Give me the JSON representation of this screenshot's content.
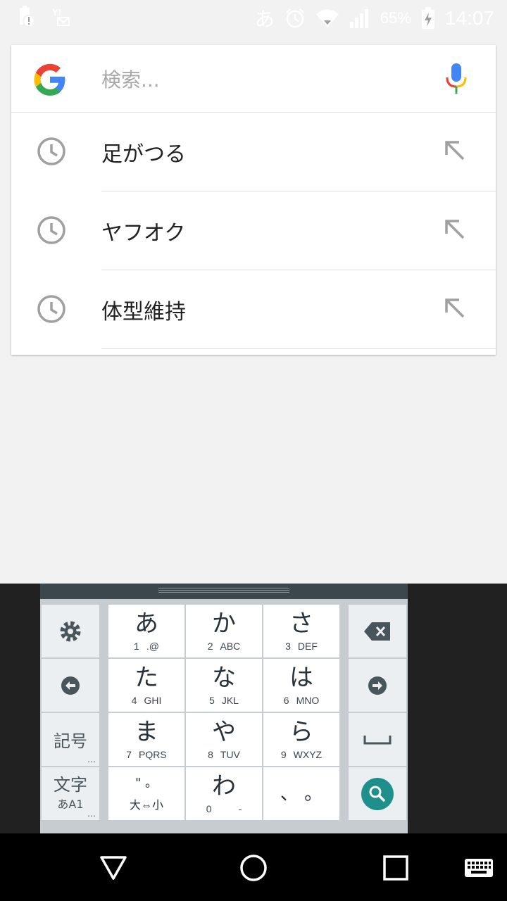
{
  "status_bar": {
    "ime_label": "あ",
    "battery_percent": "65%",
    "time": "14:07"
  },
  "search": {
    "placeholder": "検索..."
  },
  "suggestions": [
    {
      "text": "足がつる"
    },
    {
      "text": "ヤフオク"
    },
    {
      "text": "体型維持"
    }
  ],
  "keyboard": {
    "keys": [
      {
        "main": "あ",
        "sub1": "1",
        "sub2": ".@"
      },
      {
        "main": "か",
        "sub1": "2",
        "sub2": "ABC"
      },
      {
        "main": "さ",
        "sub1": "3",
        "sub2": "DEF"
      },
      {
        "main": "た",
        "sub1": "4",
        "sub2": "GHI"
      },
      {
        "main": "な",
        "sub1": "5",
        "sub2": "JKL"
      },
      {
        "main": "は",
        "sub1": "6",
        "sub2": "MNO"
      },
      {
        "main": "ま",
        "sub1": "7",
        "sub2": "PQRS"
      },
      {
        "main": "や",
        "sub1": "8",
        "sub2": "TUV"
      },
      {
        "main": "ら",
        "sub1": "9",
        "sub2": "WXYZ"
      },
      {
        "main": "\"  。",
        "sub1": "大⇔小",
        "sub2": ""
      },
      {
        "main": "わ",
        "sub1": "0",
        "sub2": "-"
      },
      {
        "main": "、 。",
        "sub1": "",
        "sub2": ""
      }
    ],
    "symbols_label": "記号",
    "mode_label": "文字",
    "mode_sub": "あA1",
    "more_dots": "…"
  },
  "colors": {
    "accent": "#1f8f8c",
    "keyboard_bg": "#c6ccd0",
    "handle": "#3b464d"
  }
}
